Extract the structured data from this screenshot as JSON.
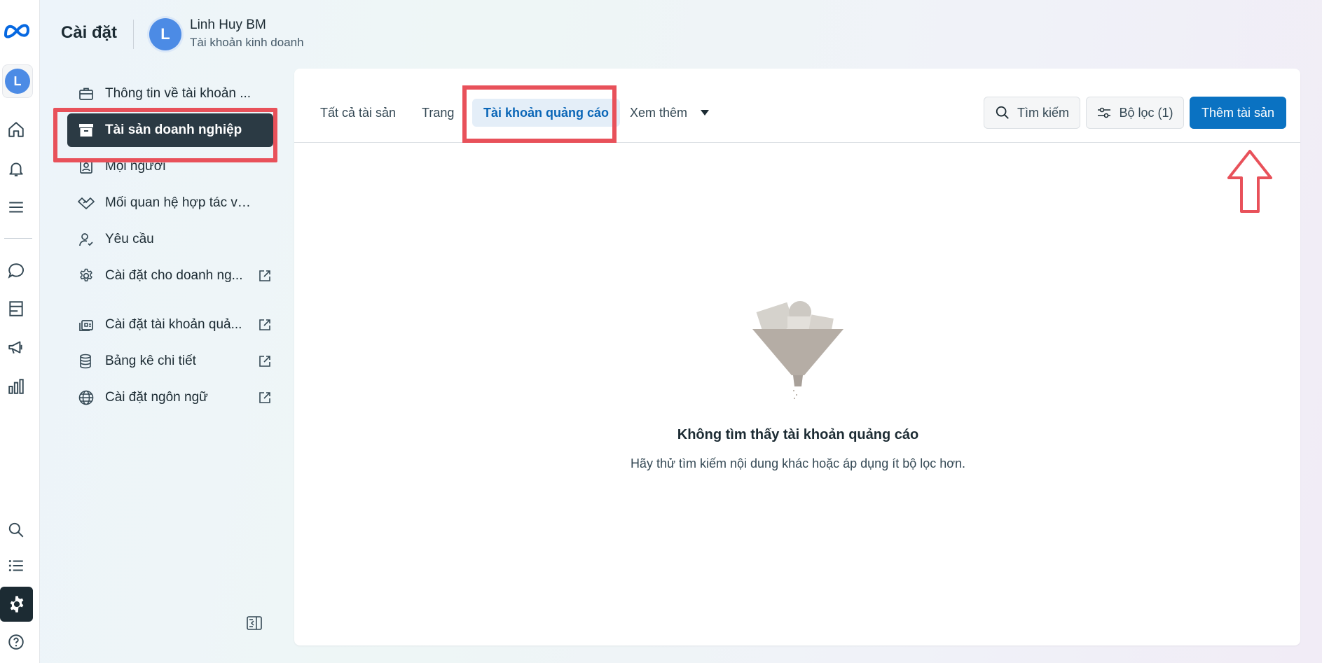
{
  "header": {
    "title": "Cài đặt",
    "business": {
      "avatar_letter": "L",
      "name": "Linh Huy BM",
      "type": "Tài khoản kinh doanh"
    }
  },
  "rail": {
    "account_letter": "L",
    "icons": [
      "meta-logo",
      "home-icon",
      "bell-icon",
      "menu-icon",
      "chat-icon",
      "pages-icon",
      "megaphone-icon",
      "bar-chart-icon",
      "search-icon",
      "list-icon",
      "gear-icon",
      "help-icon"
    ],
    "active": "gear-icon"
  },
  "nav": {
    "items": [
      {
        "label": "Thông tin về tài khoản ...",
        "icon": "briefcase-icon",
        "external": false
      },
      {
        "label": "Tài sản doanh nghiệp",
        "icon": "archive-icon",
        "external": false,
        "active": true
      },
      {
        "label": "Mọi người",
        "icon": "people-icon",
        "external": false
      },
      {
        "label": "Mối quan hệ hợp tác về...",
        "icon": "handshake-icon",
        "external": false
      },
      {
        "label": "Yêu cầu",
        "icon": "user-check-icon",
        "external": false
      },
      {
        "label": "Cài đặt cho doanh ng...",
        "icon": "gear-icon",
        "external": true
      },
      {
        "label": "Cài đặt tài khoản quả...",
        "icon": "ad-account-icon",
        "external": true
      },
      {
        "label": "Bảng kê chi tiết",
        "icon": "coins-icon",
        "external": true
      },
      {
        "label": "Cài đặt ngôn ngữ",
        "icon": "globe-icon",
        "external": true
      }
    ]
  },
  "tabs": {
    "all": "Tất cả tài sản",
    "pages": "Trang",
    "ad_accounts": "Tài khoản quảng cáo",
    "more": "Xem thêm",
    "active": "ad_accounts"
  },
  "toolbar": {
    "search_label": "Tìm kiếm",
    "filter_label": "Bộ lọc (1)",
    "add_label": "Thêm tài sản"
  },
  "empty_state": {
    "title": "Không tìm thấy tài khoản quảng cáo",
    "subtitle": "Hãy thử tìm kiếm nội dung khác hoặc áp dụng ít bộ lọc hơn."
  },
  "colors": {
    "primary": "#0a72c2",
    "active_nav": "#2b3a44",
    "highlight_annotation": "#e8515a",
    "active_tab_bg": "#e4eef8"
  }
}
